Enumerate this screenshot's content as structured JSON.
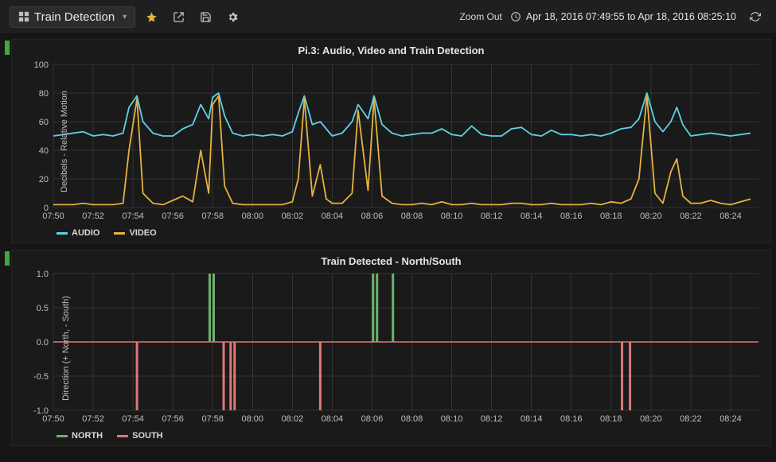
{
  "topbar": {
    "dashboard_name": "Train Detection",
    "zoom_out_label": "Zoom Out",
    "time_range": "Apr 18, 2016 07:49:55 to Apr 18, 2016 08:25:10"
  },
  "panel1": {
    "title": "Pi.3: Audio, Video and Train Detection",
    "ylabel": "Decibels - Relative Motion",
    "legend": {
      "audio": "AUDIO",
      "video": "VIDEO"
    }
  },
  "panel2": {
    "title": "Train Detected - North/South",
    "ylabel": "Direction (+ North, - South)",
    "legend": {
      "north": "NORTH",
      "south": "SOUTH"
    }
  },
  "chart_data": [
    {
      "type": "line",
      "title": "Pi.3: Audio, Video and Train Detection",
      "xlabel": "time",
      "ylabel": "Decibels - Relative Motion",
      "ylim": [
        0,
        100
      ],
      "yticks": [
        0,
        20,
        40,
        60,
        80,
        100
      ],
      "xticks": [
        "07:50",
        "07:52",
        "07:54",
        "07:56",
        "07:58",
        "08:00",
        "08:02",
        "08:04",
        "08:06",
        "08:08",
        "08:10",
        "08:12",
        "08:14",
        "08:16",
        "08:18",
        "08:20",
        "08:22",
        "08:24"
      ],
      "xrange_minutes": [
        470.0,
        505.4
      ],
      "series": [
        {
          "name": "AUDIO",
          "color": "#5dd2e8",
          "x_minutes": [
            470.0,
            470.5,
            471.0,
            471.5,
            472.0,
            472.5,
            473.0,
            473.5,
            473.8,
            474.2,
            474.5,
            475.0,
            475.5,
            476.0,
            476.5,
            477.0,
            477.4,
            477.8,
            478.0,
            478.3,
            478.6,
            479.0,
            479.5,
            480.0,
            480.5,
            481.0,
            481.5,
            482.0,
            482.3,
            482.6,
            483.0,
            483.4,
            483.7,
            484.0,
            484.5,
            485.0,
            485.3,
            485.8,
            486.1,
            486.5,
            487.0,
            487.5,
            488.0,
            488.5,
            489.0,
            489.5,
            490.0,
            490.5,
            491.0,
            491.5,
            492.0,
            492.5,
            493.0,
            493.5,
            494.0,
            494.5,
            495.0,
            495.5,
            496.0,
            496.5,
            497.0,
            497.5,
            498.0,
            498.5,
            499.0,
            499.4,
            499.8,
            500.2,
            500.6,
            501.0,
            501.3,
            501.6,
            502.0,
            502.5,
            503.0,
            503.5,
            504.0,
            504.5,
            505.0
          ],
          "values": [
            50,
            51,
            52,
            53,
            50,
            51,
            50,
            52,
            70,
            78,
            60,
            52,
            50,
            50,
            55,
            58,
            72,
            62,
            77,
            80,
            64,
            52,
            50,
            51,
            50,
            51,
            50,
            53,
            66,
            78,
            58,
            60,
            55,
            50,
            52,
            60,
            72,
            62,
            78,
            58,
            52,
            50,
            51,
            52,
            52,
            55,
            51,
            50,
            57,
            51,
            50,
            50,
            55,
            56,
            51,
            50,
            54,
            51,
            51,
            50,
            51,
            50,
            52,
            55,
            56,
            62,
            80,
            60,
            53,
            60,
            70,
            58,
            50,
            51,
            52,
            51,
            50,
            51,
            52
          ]
        },
        {
          "name": "VIDEO",
          "color": "#e6b23f",
          "x_minutes": [
            470.0,
            470.5,
            471.0,
            471.5,
            472.0,
            472.5,
            473.0,
            473.5,
            473.8,
            474.2,
            474.5,
            475.0,
            475.5,
            476.0,
            476.5,
            477.0,
            477.4,
            477.8,
            478.0,
            478.3,
            478.6,
            479.0,
            479.5,
            480.0,
            480.5,
            481.0,
            481.5,
            482.0,
            482.3,
            482.6,
            483.0,
            483.4,
            483.7,
            484.0,
            484.5,
            485.0,
            485.3,
            485.8,
            486.1,
            486.5,
            487.0,
            487.5,
            488.0,
            488.5,
            489.0,
            489.5,
            490.0,
            490.5,
            491.0,
            491.5,
            492.0,
            492.5,
            493.0,
            493.5,
            494.0,
            494.5,
            495.0,
            495.5,
            496.0,
            496.5,
            497.0,
            497.5,
            498.0,
            498.5,
            499.0,
            499.4,
            499.8,
            500.2,
            500.6,
            501.0,
            501.3,
            501.6,
            502.0,
            502.5,
            503.0,
            503.5,
            504.0,
            504.5,
            505.0
          ],
          "values": [
            2,
            2,
            2,
            3,
            2,
            2,
            2,
            3,
            40,
            76,
            10,
            3,
            2,
            5,
            8,
            4,
            40,
            10,
            72,
            78,
            15,
            3,
            2,
            2,
            2,
            2,
            2,
            4,
            20,
            76,
            8,
            30,
            6,
            3,
            3,
            10,
            68,
            12,
            76,
            8,
            3,
            2,
            2,
            3,
            2,
            4,
            2,
            2,
            3,
            2,
            2,
            2,
            3,
            3,
            2,
            2,
            3,
            2,
            2,
            2,
            3,
            2,
            4,
            3,
            6,
            20,
            78,
            10,
            3,
            25,
            34,
            8,
            3,
            3,
            5,
            3,
            2,
            4,
            6
          ]
        }
      ]
    },
    {
      "type": "bar",
      "title": "Train Detected - North/South",
      "xlabel": "time",
      "ylabel": "Direction (+ North, - South)",
      "ylim": [
        -1,
        1
      ],
      "yticks": [
        -1.0,
        -0.5,
        0,
        0.5,
        1.0
      ],
      "xticks": [
        "07:50",
        "07:52",
        "07:54",
        "07:56",
        "07:58",
        "08:00",
        "08:02",
        "08:04",
        "08:06",
        "08:08",
        "08:10",
        "08:12",
        "08:14",
        "08:16",
        "08:18",
        "08:20",
        "08:22",
        "08:24"
      ],
      "xrange_minutes": [
        470.0,
        505.4
      ],
      "series": [
        {
          "name": "NORTH",
          "color": "#6bb36b",
          "x_minutes": [
            477.85,
            478.05,
            486.05,
            486.25,
            487.05
          ],
          "values": [
            1,
            1,
            1,
            1,
            1
          ]
        },
        {
          "name": "SOUTH",
          "color": "#e07777",
          "x_minutes": [
            474.2,
            478.55,
            478.9,
            479.1,
            483.4,
            498.55,
            498.95
          ],
          "values": [
            -1,
            -1,
            -1,
            -1,
            -1,
            -1,
            -1
          ]
        }
      ]
    }
  ]
}
